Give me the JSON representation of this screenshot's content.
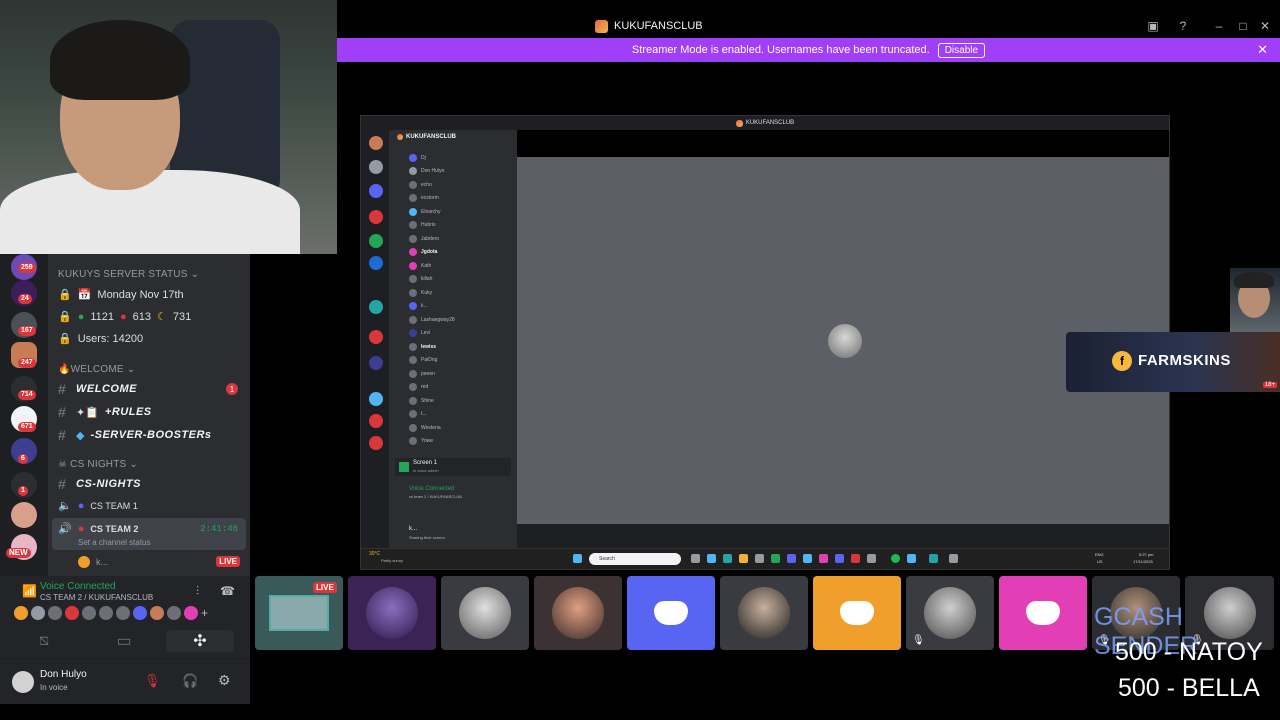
{
  "window": {
    "title": "KUKUFANSCLUB",
    "controls": [
      "inbox-icon",
      "help-icon",
      "minimize",
      "maximize",
      "close"
    ]
  },
  "banner": {
    "text": "Streamer Mode is enabled. Usernames have been truncated.",
    "button": "Disable"
  },
  "servers": [
    {
      "badge": "259"
    },
    {
      "badge": "24"
    },
    {
      "badge": "167"
    },
    {
      "badge": "247"
    },
    {
      "badge": "714"
    },
    {
      "badge": "671"
    },
    {
      "badge": "6"
    },
    {
      "badge": "1"
    },
    {
      "badge": "NEW"
    }
  ],
  "channels": {
    "status_category": "KUKUYS SERVER STATUS",
    "date_channel": "Monday Nov 17th",
    "counts_channel": {
      "green": "1121",
      "red": "613",
      "moon": "731"
    },
    "users_channel": "Users: 14200",
    "welcome_category": "WELCOME",
    "welcome": "WELCOME",
    "welcome_unread": "1",
    "rules": "+RULES",
    "boosters": "-SERVER-BOOSTERs",
    "cs_category": "CS NIGHTS",
    "cs_nights": "CS-NIGHTS",
    "team1": "CS TEAM 1",
    "team2": "CS TEAM 2",
    "team2_timer": "2:41:46",
    "team2_status": "Set a channel status",
    "team2_user": "k...",
    "live": "LIVE"
  },
  "voice": {
    "status": "Voice Connected",
    "channel": "CS TEAM 2 / KUKUFANSCLUB"
  },
  "user": {
    "name": "Don Hulyo",
    "status": "In voice"
  },
  "share": {
    "title": "KUKUFANSCLUB",
    "server_name": "KUKUFANSCLUB",
    "members": [
      "Dj",
      "Don Hulyo",
      "echo",
      "ecstorm",
      "Elnarchy",
      "Hubris",
      "Jabdero",
      "Jgdota",
      "Kath",
      "killah",
      "Kuky",
      "k...",
      "Lashaegway28",
      "Levi",
      "lewiss",
      "PaiDng",
      "peeen",
      "red",
      "Shine",
      "t...",
      "Westeria",
      "Yowe"
    ],
    "screen": "Screen 1",
    "screen_sub": "in voice admin",
    "voice_connected": "Voice Connected",
    "voice_channel": "cs team 2 / KUKUFANSCLUB",
    "user": "k...",
    "user_sub": "Sharing their screen",
    "weather": "30°C",
    "weather_sub": "Partly sunny",
    "search": "Search",
    "lang": "ENG",
    "lang_sub": "US",
    "time": "5:27 pm",
    "date": "17/11/2025"
  },
  "farmskins": {
    "label": "FARMSKINS",
    "age": "18+"
  },
  "tiles": {
    "live": "LIVE"
  },
  "donations": [
    "GCASH SENDER",
    "500 - NATOY",
    "500  - BELLA"
  ],
  "colors": {
    "banner": "#a13ef8",
    "discord_blurple": "#5865f2",
    "discord_orange": "#f0a02a",
    "discord_pink": "#e23fb6",
    "voice_green": "#23a55a",
    "live_red": "#da373c"
  }
}
